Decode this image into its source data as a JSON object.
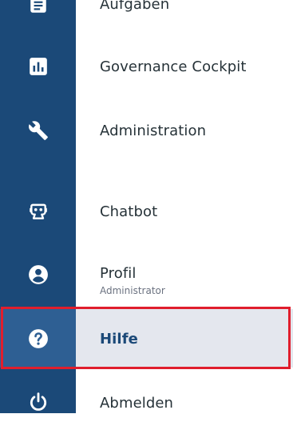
{
  "menu": {
    "items": [
      {
        "label": "Aufgaben",
        "icon": "task-list-icon"
      },
      {
        "label": "Governance Cockpit",
        "icon": "bar-chart-icon"
      },
      {
        "label": "Administration",
        "icon": "wrench-icon"
      },
      {
        "label": "Chatbot",
        "icon": "robot-icon"
      },
      {
        "label": "Profil",
        "sublabel": "Administrator",
        "icon": "user-circle-icon"
      },
      {
        "label": "Hilfe",
        "icon": "help-circle-icon",
        "active": true
      },
      {
        "label": "Abmelden",
        "icon": "power-icon"
      }
    ]
  },
  "colors": {
    "rail": "#1b4978",
    "active_icon_cell": "#2e5f93",
    "active_row": "#e4e7ee",
    "active_text": "#1b4978",
    "highlight_border": "#e01e2d"
  }
}
